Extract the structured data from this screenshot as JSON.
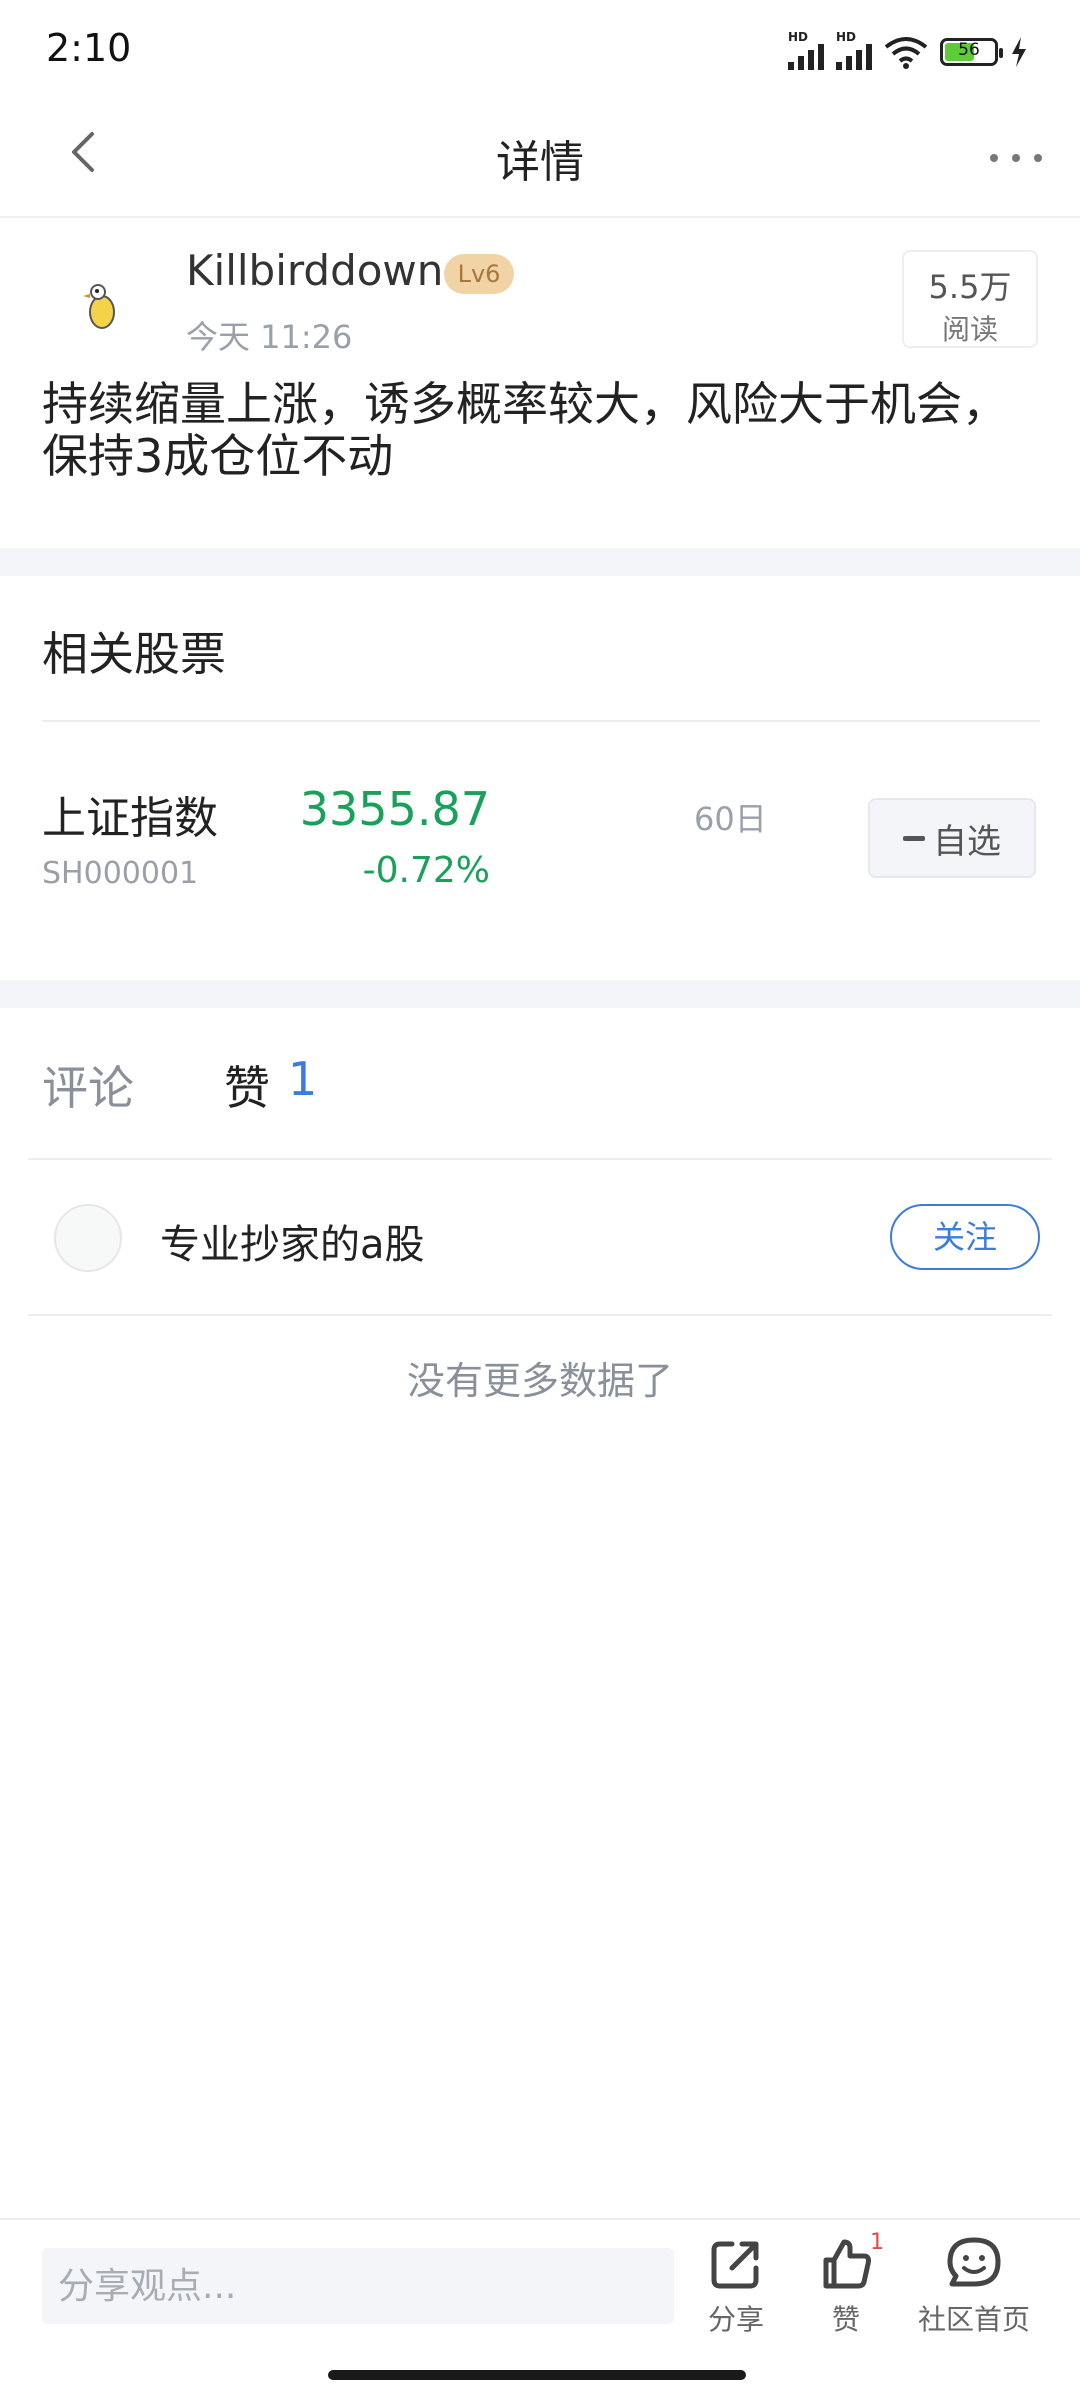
{
  "status_bar": {
    "time": "2:10",
    "battery": "56",
    "signal_label": "HD"
  },
  "header": {
    "title": "详情"
  },
  "post": {
    "author": "Killbirddown",
    "level": "Lv6",
    "time": "今天 11:26",
    "read_count": "5.5万",
    "read_label": "阅读",
    "text": "持续缩量上涨，诱多概率较大，风险大于机会，保持3成仓位不动"
  },
  "related": {
    "title": "相关股票",
    "stock": {
      "name": "上证指数",
      "code": "SH000001",
      "price": "3355.87",
      "change": "-0.72%",
      "period": "60日",
      "watch_label": "自选"
    }
  },
  "tabs": {
    "comment": "评论",
    "like": "赞",
    "like_count": "1"
  },
  "likers": [
    {
      "name": "专业抄家的a股",
      "follow_label": "关注"
    }
  ],
  "no_more": "没有更多数据了",
  "bottom_bar": {
    "input_placeholder": "分享观点...",
    "share_label": "分享",
    "like_label": "赞",
    "like_badge": "1",
    "community_label": "社区首页"
  },
  "colors": {
    "up_down_green": "#19a15a",
    "accent_blue": "#3d7be0",
    "level_badge": "#f2d3a6"
  }
}
